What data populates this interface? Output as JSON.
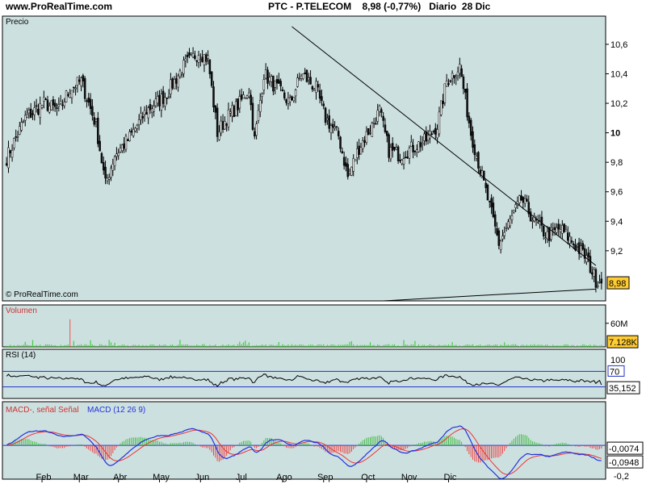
{
  "header": {
    "site": "www.ProRealTime.com",
    "ticker": "PTC - P.TELECOM",
    "price": "8,98",
    "change": "(-0,77%)",
    "period": "Diario",
    "date": "28 Dic"
  },
  "colors": {
    "panel_bg": "#cde0e0",
    "up_candle": "#f0f0f0",
    "down_candle": "#101010",
    "badge_bg": "#ffcc33",
    "volume": "#44cc44",
    "volume_spike": "#ee6666",
    "rsi_line": "#000000",
    "rsi_levels": "#2030cc",
    "macd_line": "#2233dd",
    "signal_line": "#ee3333",
    "hist_pos": "#44bb44",
    "hist_neg": "#ee4444"
  },
  "chart_data": {
    "type": "candlestick",
    "months": [
      "Feb",
      "Mar",
      "Abr",
      "May",
      "Jun",
      "Jul",
      "Ago",
      "Sep",
      "Oct",
      "Nov",
      "Dic"
    ],
    "price_panel": {
      "label": "Precio",
      "ylim": [
        8.86,
        10.72
      ],
      "ticks": [
        "10,6",
        "10,4",
        "10,2",
        "10",
        "9,8",
        "9,6",
        "9,4",
        "9,2"
      ],
      "last_badge": "8,98",
      "watermark": "© ProRealTime.com",
      "close_waypoints": [
        [
          0,
          9.83
        ],
        [
          10,
          10.1
        ],
        [
          20,
          10.2
        ],
        [
          28,
          10.15
        ],
        [
          34,
          10.3
        ],
        [
          40,
          10.35
        ],
        [
          48,
          10.05
        ],
        [
          53,
          9.65
        ],
        [
          58,
          9.85
        ],
        [
          65,
          9.95
        ],
        [
          75,
          10.15
        ],
        [
          85,
          10.25
        ],
        [
          95,
          10.45
        ],
        [
          103,
          10.55
        ],
        [
          108,
          10.5
        ],
        [
          113,
          10.0
        ],
        [
          118,
          10.1
        ],
        [
          125,
          10.2
        ],
        [
          130,
          10.3
        ],
        [
          133,
          9.95
        ],
        [
          138,
          10.4
        ],
        [
          145,
          10.3
        ],
        [
          152,
          10.2
        ],
        [
          158,
          10.4
        ],
        [
          166,
          10.3
        ],
        [
          171,
          10.1
        ],
        [
          178,
          9.98
        ],
        [
          183,
          9.7
        ],
        [
          189,
          9.9
        ],
        [
          196,
          10.05
        ],
        [
          200,
          10.15
        ],
        [
          205,
          9.88
        ],
        [
          211,
          9.85
        ],
        [
          218,
          9.9
        ],
        [
          225,
          9.95
        ],
        [
          231,
          10.05
        ],
        [
          236,
          10.35
        ],
        [
          243,
          10.45
        ],
        [
          249,
          10.0
        ],
        [
          257,
          9.6
        ],
        [
          264,
          9.25
        ],
        [
          270,
          9.4
        ],
        [
          276,
          9.55
        ],
        [
          283,
          9.4
        ],
        [
          290,
          9.3
        ],
        [
          297,
          9.35
        ],
        [
          304,
          9.25
        ],
        [
          311,
          9.15
        ],
        [
          316,
          9.0
        ]
      ],
      "resistance_line": {
        "from": [
          153,
          10.72
        ],
        "to": [
          316,
          9.1
        ]
      },
      "support_line": {
        "from": [
          202,
          8.86
        ],
        "to": [
          316,
          8.94
        ]
      }
    },
    "volume_panel": {
      "label": "Volumen",
      "ylim": [
        0,
        80
      ],
      "ticks": [
        "60M"
      ],
      "last_badge": "7.128K",
      "spike_index": 34,
      "spike_value": 70
    },
    "rsi_panel": {
      "label": "RSI (14)",
      "ylim": [
        0,
        100
      ],
      "ticks": [
        "100"
      ],
      "levels": [
        70,
        30
      ],
      "level_labels": [
        "70"
      ],
      "last_badge": "35,152"
    },
    "macd_panel": {
      "label_signal": "MACD-, señal Señal",
      "label_macd": "MACD (12 26 9)",
      "ylim": [
        -0.22,
        0.2
      ],
      "ticks": [
        "-0,2"
      ],
      "badges": [
        "-0,0074",
        "-0,0948"
      ]
    }
  }
}
